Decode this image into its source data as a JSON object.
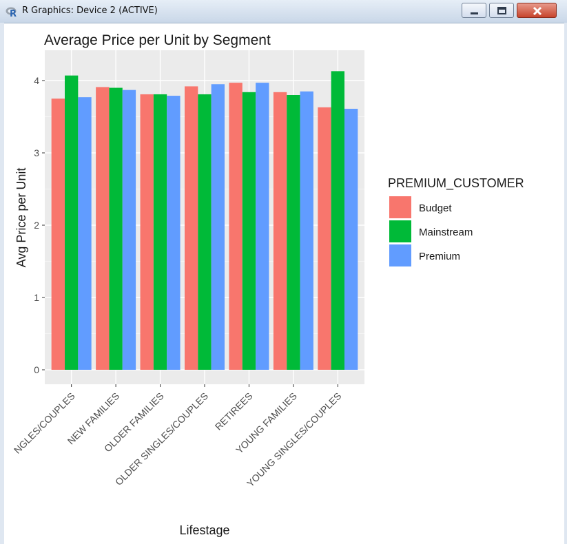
{
  "window": {
    "title": "R Graphics: Device 2 (ACTIVE)",
    "icons": {
      "app": "r-logo-icon",
      "minimize": "minimize-icon",
      "maximize": "maximize-icon",
      "close": "close-icon"
    }
  },
  "chart_data": {
    "type": "bar",
    "title": "Average Price per Unit by Segment",
    "xlabel": "Lifestage",
    "ylabel": "Avg Price per Unit",
    "ylim": [
      0,
      4.3
    ],
    "yticks": [
      0,
      1,
      2,
      3,
      4
    ],
    "categories": [
      "MIDAGE SINGLES/COUPLES",
      "NEW FAMILIES",
      "OLDER FAMILIES",
      "OLDER SINGLES/COUPLES",
      "RETIREES",
      "YOUNG FAMILIES",
      "YOUNG SINGLES/COUPLES"
    ],
    "category_labels_visible": [
      "NGLES/COUPLES",
      "NEW FAMILIES",
      "OLDER FAMILIES",
      "OLDER SINGLES/COUPLES",
      "RETIREES",
      "YOUNG FAMILIES",
      "YOUNG SINGLES/COUPLES"
    ],
    "series": [
      {
        "name": "Budget",
        "color": "#F8766D",
        "values": [
          3.75,
          3.91,
          3.81,
          3.92,
          3.97,
          3.84,
          3.63
        ]
      },
      {
        "name": "Mainstream",
        "color": "#00BA38",
        "values": [
          4.07,
          3.9,
          3.81,
          3.81,
          3.84,
          3.8,
          4.13
        ]
      },
      {
        "name": "Premium",
        "color": "#619CFF",
        "values": [
          3.77,
          3.87,
          3.79,
          3.95,
          3.97,
          3.85,
          3.61
        ]
      }
    ],
    "legend_title": "PREMIUM_CUSTOMER",
    "legend_position": "right",
    "grid": true,
    "panel_background": "#EBEBEB"
  }
}
